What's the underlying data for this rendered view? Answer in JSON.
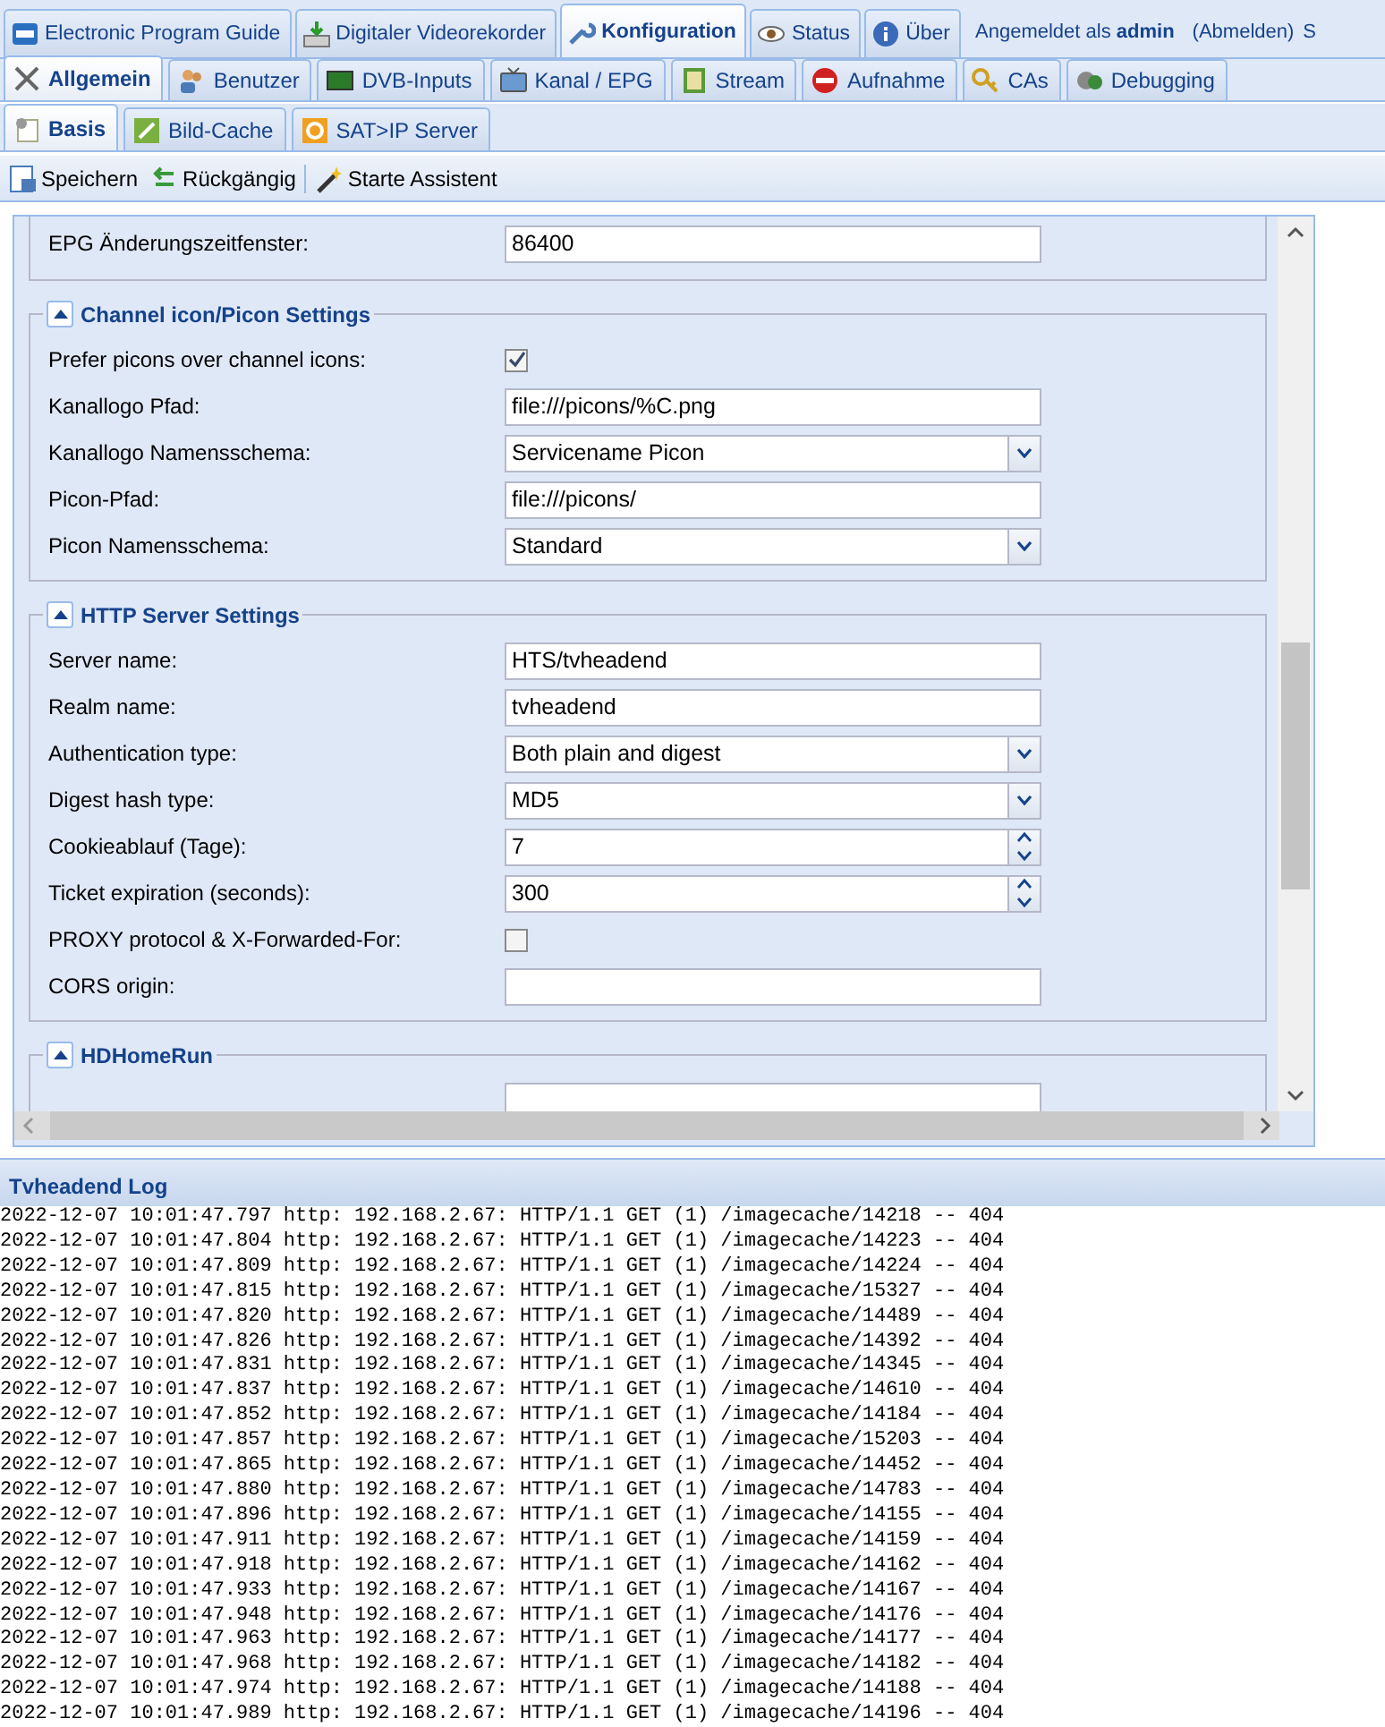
{
  "top_tabs": [
    {
      "label": "Electronic Program Guide",
      "selected": false
    },
    {
      "label": "Digitaler Videorekorder",
      "selected": false
    },
    {
      "label": "Konfiguration",
      "selected": true
    },
    {
      "label": "Status",
      "selected": false
    },
    {
      "label": "Über",
      "selected": false
    }
  ],
  "user_info": {
    "text": "Angemeldet als **admin**",
    "logout": "(Abmelden)",
    "cut_text": "S"
  },
  "config_tabs": [
    {
      "label": "Allgemein",
      "selected": true
    },
    {
      "label": "Benutzer",
      "selected": false
    },
    {
      "label": "DVB-Inputs",
      "selected": false
    },
    {
      "label": "Kanal / EPG",
      "selected": false
    },
    {
      "label": "Stream",
      "selected": false
    },
    {
      "label": "Aufnahme",
      "selected": false
    },
    {
      "label": "CAs",
      "selected": false
    },
    {
      "label": "Debugging",
      "selected": false
    }
  ],
  "sub_tabs": [
    {
      "label": "Basis",
      "selected": true
    },
    {
      "label": "Bild-Cache",
      "selected": false
    },
    {
      "label": "SAT>IP Server",
      "selected": false
    }
  ],
  "toolbar": [
    {
      "label": "Speichern"
    },
    {
      "label": "Rückgängig"
    },
    {
      "label": "Starte Assistent"
    }
  ],
  "sections": [
    {
      "fields": [
        {
          "kind": "text",
          "label": "EPG Änderungszeitfenster:",
          "value": "86400"
        }
      ]
    },
    {
      "title": "Channel icon/Picon Settings",
      "expanded": true,
      "fields": [
        {
          "kind": "checkbox",
          "label": "Prefer picons over channel icons:",
          "checked": true
        },
        {
          "kind": "text",
          "label": "Kanallogo Pfad:",
          "value": "file:///picons/%C.png"
        },
        {
          "kind": "select",
          "label": "Kanallogo Namensschema:",
          "value": "Servicename Picon"
        },
        {
          "kind": "text",
          "label": "Picon-Pfad:",
          "value": "file:///picons/"
        },
        {
          "kind": "select",
          "label": "Picon Namensschema:",
          "value": "Standard"
        }
      ]
    },
    {
      "title": "HTTP Server Settings",
      "expanded": true,
      "fields": [
        {
          "kind": "text",
          "label": "Server name:",
          "value": "HTS/tvheadend"
        },
        {
          "kind": "text",
          "label": "Realm name:",
          "value": "tvheadend"
        },
        {
          "kind": "select",
          "label": "Authentication type:",
          "value": "Both plain and digest"
        },
        {
          "kind": "select",
          "label": "Digest hash type:",
          "value": "MD5"
        },
        {
          "kind": "spinner",
          "label": "Cookieablauf (Tage):",
          "value": "7"
        },
        {
          "kind": "spinner",
          "label": "Ticket expiration (seconds):",
          "value": "300"
        },
        {
          "kind": "checkbox",
          "label": "PROXY protocol & X-Forwarded-For:",
          "checked": false
        },
        {
          "kind": "text",
          "label": "CORS origin:"
        }
      ]
    },
    {
      "title": "HDHomeRun",
      "expanded": true,
      "fields": [
        {
          "kind": "text"
        }
      ]
    }
  ],
  "log": {
    "title": "Tvheadend Log",
    "lines": [
      "2022-12-07 10:01:47.797 http: 192.168.2.67: HTTP/1.1 GET (1) /imagecache/14218 -- 404",
      "2022-12-07 10:01:47.804 http: 192.168.2.67: HTTP/1.1 GET (1) /imagecache/14223 -- 404",
      "2022-12-07 10:01:47.809 http: 192.168.2.67: HTTP/1.1 GET (1) /imagecache/14224 -- 404",
      "2022-12-07 10:01:47.815 http: 192.168.2.67: HTTP/1.1 GET (1) /imagecache/15327 -- 404",
      "2022-12-07 10:01:47.820 http: 192.168.2.67: HTTP/1.1 GET (1) /imagecache/14489 -- 404",
      "2022-12-07 10:01:47.826 http: 192.168.2.67: HTTP/1.1 GET (1) /imagecache/14392 -- 404",
      "2022-12-07 10:01:47.831 http: 192.168.2.67: HTTP/1.1 GET (1) /imagecache/14345 -- 404",
      "2022-12-07 10:01:47.837 http: 192.168.2.67: HTTP/1.1 GET (1) /imagecache/14610 -- 404",
      "2022-12-07 10:01:47.852 http: 192.168.2.67: HTTP/1.1 GET (1) /imagecache/14184 -- 404",
      "2022-12-07 10:01:47.857 http: 192.168.2.67: HTTP/1.1 GET (1) /imagecache/15203 -- 404",
      "2022-12-07 10:01:47.865 http: 192.168.2.67: HTTP/1.1 GET (1) /imagecache/14452 -- 404",
      "2022-12-07 10:01:47.880 http: 192.168.2.67: HTTP/1.1 GET (1) /imagecache/14783 -- 404",
      "2022-12-07 10:01:47.896 http: 192.168.2.67: HTTP/1.1 GET (1) /imagecache/14155 -- 404",
      "2022-12-07 10:01:47.911 http: 192.168.2.67: HTTP/1.1 GET (1) /imagecache/14159 -- 404",
      "2022-12-07 10:01:47.918 http: 192.168.2.67: HTTP/1.1 GET (1) /imagecache/14162 -- 404",
      "2022-12-07 10:01:47.933 http: 192.168.2.67: HTTP/1.1 GET (1) /imagecache/14167 -- 404",
      "2022-12-07 10:01:47.948 http: 192.168.2.67: HTTP/1.1 GET (1) /imagecache/14176 -- 404",
      "2022-12-07 10:01:47.963 http: 192.168.2.67: HTTP/1.1 GET (1) /imagecache/14177 -- 404",
      "2022-12-07 10:01:47.968 http: 192.168.2.67: HTTP/1.1 GET (1) /imagecache/14182 -- 404",
      "2022-12-07 10:01:47.974 http: 192.168.2.67: HTTP/1.1 GET (1) /imagecache/14188 -- 404",
      "2022-12-07 10:01:47.989 http: 192.168.2.67: HTTP/1.1 GET (1) /imagecache/14196 -- 404"
    ]
  }
}
